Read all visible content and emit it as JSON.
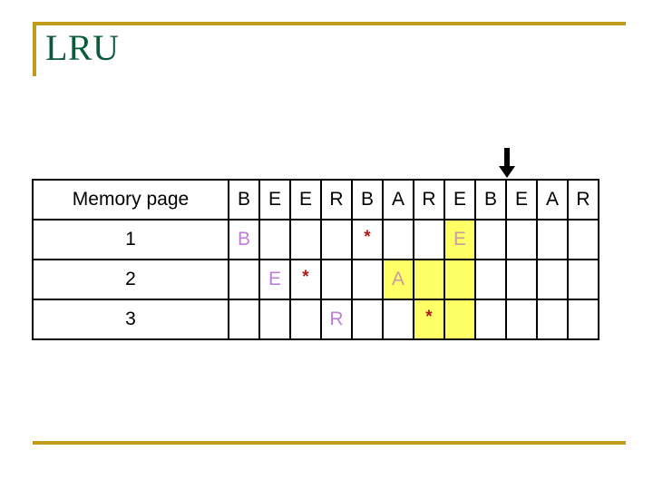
{
  "slide": {
    "title": "LRU",
    "accent_color": "#BF9C1B",
    "title_color": "#0B5B3B",
    "highlight_color": "#FFFF66",
    "page_letter_color": "#BE7FD8",
    "star_color": "#B01818"
  },
  "pointer": {
    "icon": "arrow-down-icon",
    "target_column_index": 7
  },
  "table": {
    "header": {
      "label": "Memory page",
      "reference_string": [
        "B",
        "E",
        "E",
        "R",
        "B",
        "A",
        "R",
        "E",
        "B",
        "E",
        "A",
        "R"
      ]
    },
    "rows": [
      {
        "label": "1",
        "cells": [
          {
            "text": "B",
            "highlight": false
          },
          {
            "text": "",
            "highlight": false
          },
          {
            "text": "",
            "highlight": false
          },
          {
            "text": "",
            "highlight": false
          },
          {
            "text": "*",
            "highlight": false
          },
          {
            "text": "",
            "highlight": false
          },
          {
            "text": "",
            "highlight": false
          },
          {
            "text": "E",
            "highlight": true
          },
          {
            "text": "",
            "highlight": false
          },
          {
            "text": "",
            "highlight": false
          },
          {
            "text": "",
            "highlight": false
          },
          {
            "text": "",
            "highlight": false
          }
        ]
      },
      {
        "label": "2",
        "cells": [
          {
            "text": "",
            "highlight": false
          },
          {
            "text": "E",
            "highlight": false
          },
          {
            "text": "*",
            "highlight": false
          },
          {
            "text": "",
            "highlight": false
          },
          {
            "text": "",
            "highlight": false
          },
          {
            "text": "A",
            "highlight": true
          },
          {
            "text": "",
            "highlight": true
          },
          {
            "text": "",
            "highlight": true
          },
          {
            "text": "",
            "highlight": false
          },
          {
            "text": "",
            "highlight": false
          },
          {
            "text": "",
            "highlight": false
          },
          {
            "text": "",
            "highlight": false
          }
        ]
      },
      {
        "label": "3",
        "cells": [
          {
            "text": "",
            "highlight": false
          },
          {
            "text": "",
            "highlight": false
          },
          {
            "text": "",
            "highlight": false
          },
          {
            "text": "R",
            "highlight": false
          },
          {
            "text": "",
            "highlight": false
          },
          {
            "text": "",
            "highlight": false
          },
          {
            "text": "*",
            "highlight": true
          },
          {
            "text": "",
            "highlight": true
          },
          {
            "text": "",
            "highlight": false
          },
          {
            "text": "",
            "highlight": false
          },
          {
            "text": "",
            "highlight": false
          },
          {
            "text": "",
            "highlight": false
          }
        ]
      }
    ]
  }
}
